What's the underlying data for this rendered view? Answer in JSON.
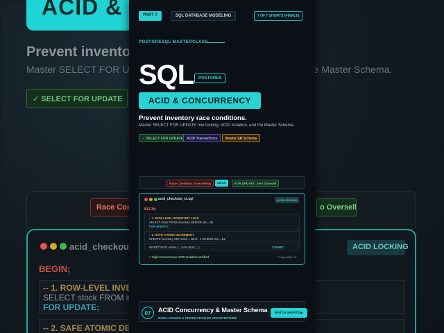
{
  "meta": {
    "part_label": "PART 7",
    "series_label": "SQL DATABASE MODELING",
    "count_label": "7 OF 7 SHORTS (FINALE)"
  },
  "hero": {
    "kicker": "POSTGRESQL MASTERCLASS",
    "big_title": "SQL",
    "engine_badge": "POSTGRES",
    "subtitle_box": "ACID & CONCURRENCY",
    "headline": "Prevent inventory race conditions.",
    "description": "Master SELECT FOR UPDATE row locking, ACID isolation, and the Master Schema.",
    "pills": [
      "✓ SELECT FOR UPDATE",
      "ACID Transactions",
      "Master ER Schema"
    ]
  },
  "race": {
    "problem": "Race Condition: Overselling",
    "lock": "LOCK",
    "solution": "FOR UPDATE: Zero Oversell"
  },
  "code_window": {
    "filename": "acid_checkout_tx.sql",
    "badge": "ACID LOCKING",
    "begin": "BEGIN;",
    "block1_comment": "-- 1. ROW-LEVEL INVENTORY LOCK",
    "block1_line1": "SELECT stock FROM inventory WHERE sku = $1",
    "block1_line2": "FOR UPDATE;",
    "block2_comment": "-- 2. SAFE ATOMIC DECREMENT",
    "block2_line1": "UPDATE inventory SET stock = stock - 1 WHERE sku = $1;",
    "block3_line1": "INSERT INTO orders (...) VALUES (...);",
    "commit": "COMMIT;",
    "verified": "✔ High-Concurrency ACID Isolation Verified",
    "engine": "PostgreSQL 16"
  },
  "footer": {
    "number": "07",
    "title": "ACID Concurrency & Master Schema",
    "subtitle": "ROW LOCKING & PRODUCTION ER ARCHITECTURE",
    "button": "WATCH SHORTS ▶"
  },
  "background": {
    "title_fragment": "ACID & C",
    "headline_fragment": "Prevent invento",
    "sub_fragment": "Master SELECT FOR U",
    "sub_right_fragment": "the Master Schema.",
    "chip": "✓ SELECT FOR UPDATE",
    "red_fragment": "Race Con",
    "green_fragment": "o Oversell",
    "file_fragment": "acid_checkout_",
    "badge": "ACID LOCKING",
    "begin": "BEGIN;",
    "block1_comment_fragment": "-- 1. ROW-LEVEL INVENTORY L",
    "block1_line1_fragment": "SELECT stock FROM invent",
    "block1_line2": "FOR UPDATE;",
    "block2_comment_fragment": "-- 2. SAFE ATOMIC DECREMEN"
  },
  "colors": {
    "accent": "#27d3d3",
    "danger": "#f27a70",
    "success": "#7fd58f",
    "warning": "#e0b44a",
    "panel": "#0b1016"
  }
}
